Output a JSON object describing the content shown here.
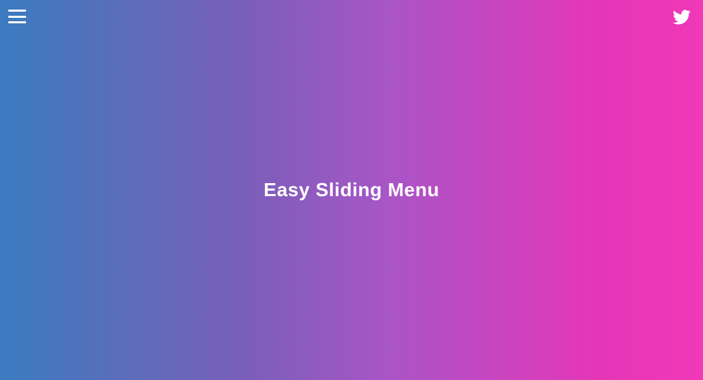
{
  "header": {
    "menu_icon": "hamburger-menu-icon",
    "social_icon": "twitter-icon"
  },
  "main": {
    "title": "Easy Sliding Menu"
  }
}
